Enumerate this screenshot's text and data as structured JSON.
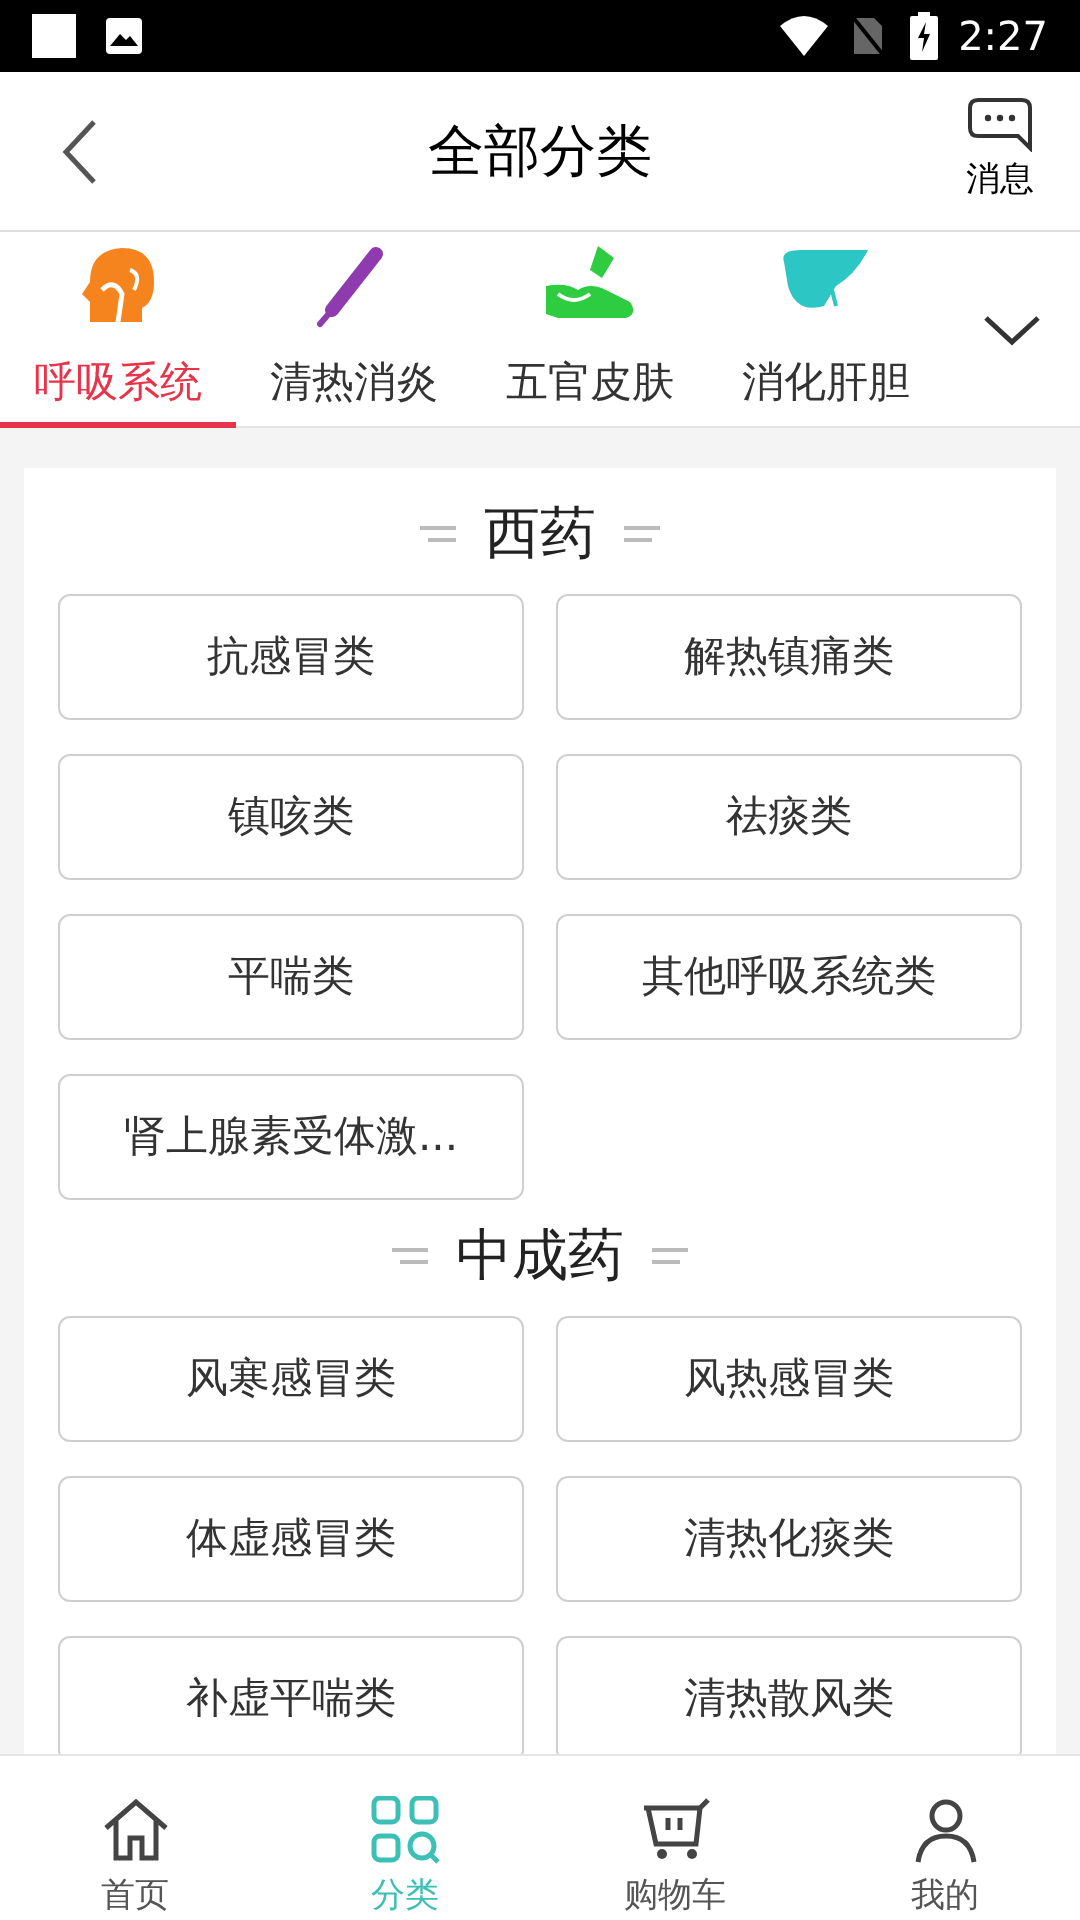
{
  "status_bar": {
    "time": "2:27"
  },
  "header": {
    "title": "全部分类",
    "message_label": "消息"
  },
  "tabs": [
    {
      "label": "呼吸系统",
      "selected": true
    },
    {
      "label": "清热消炎",
      "selected": false
    },
    {
      "label": "五官皮肤",
      "selected": false
    },
    {
      "label": "消化肝胆",
      "selected": false
    }
  ],
  "sections": [
    {
      "title": "西药",
      "items": [
        "抗感冒类",
        "解热镇痛类",
        "镇咳类",
        "祛痰类",
        "平喘类",
        "其他呼吸系统类",
        "肾上腺素受体激..."
      ]
    },
    {
      "title": "中成药",
      "items": [
        "风寒感冒类",
        "风热感冒类",
        "体虚感冒类",
        "清热化痰类",
        "补虚平喘类",
        "清热散风类"
      ]
    }
  ],
  "bottom_nav": [
    {
      "label": "首页",
      "selected": false
    },
    {
      "label": "分类",
      "selected": true
    },
    {
      "label": "购物车",
      "selected": false
    },
    {
      "label": "我的",
      "selected": false
    }
  ]
}
